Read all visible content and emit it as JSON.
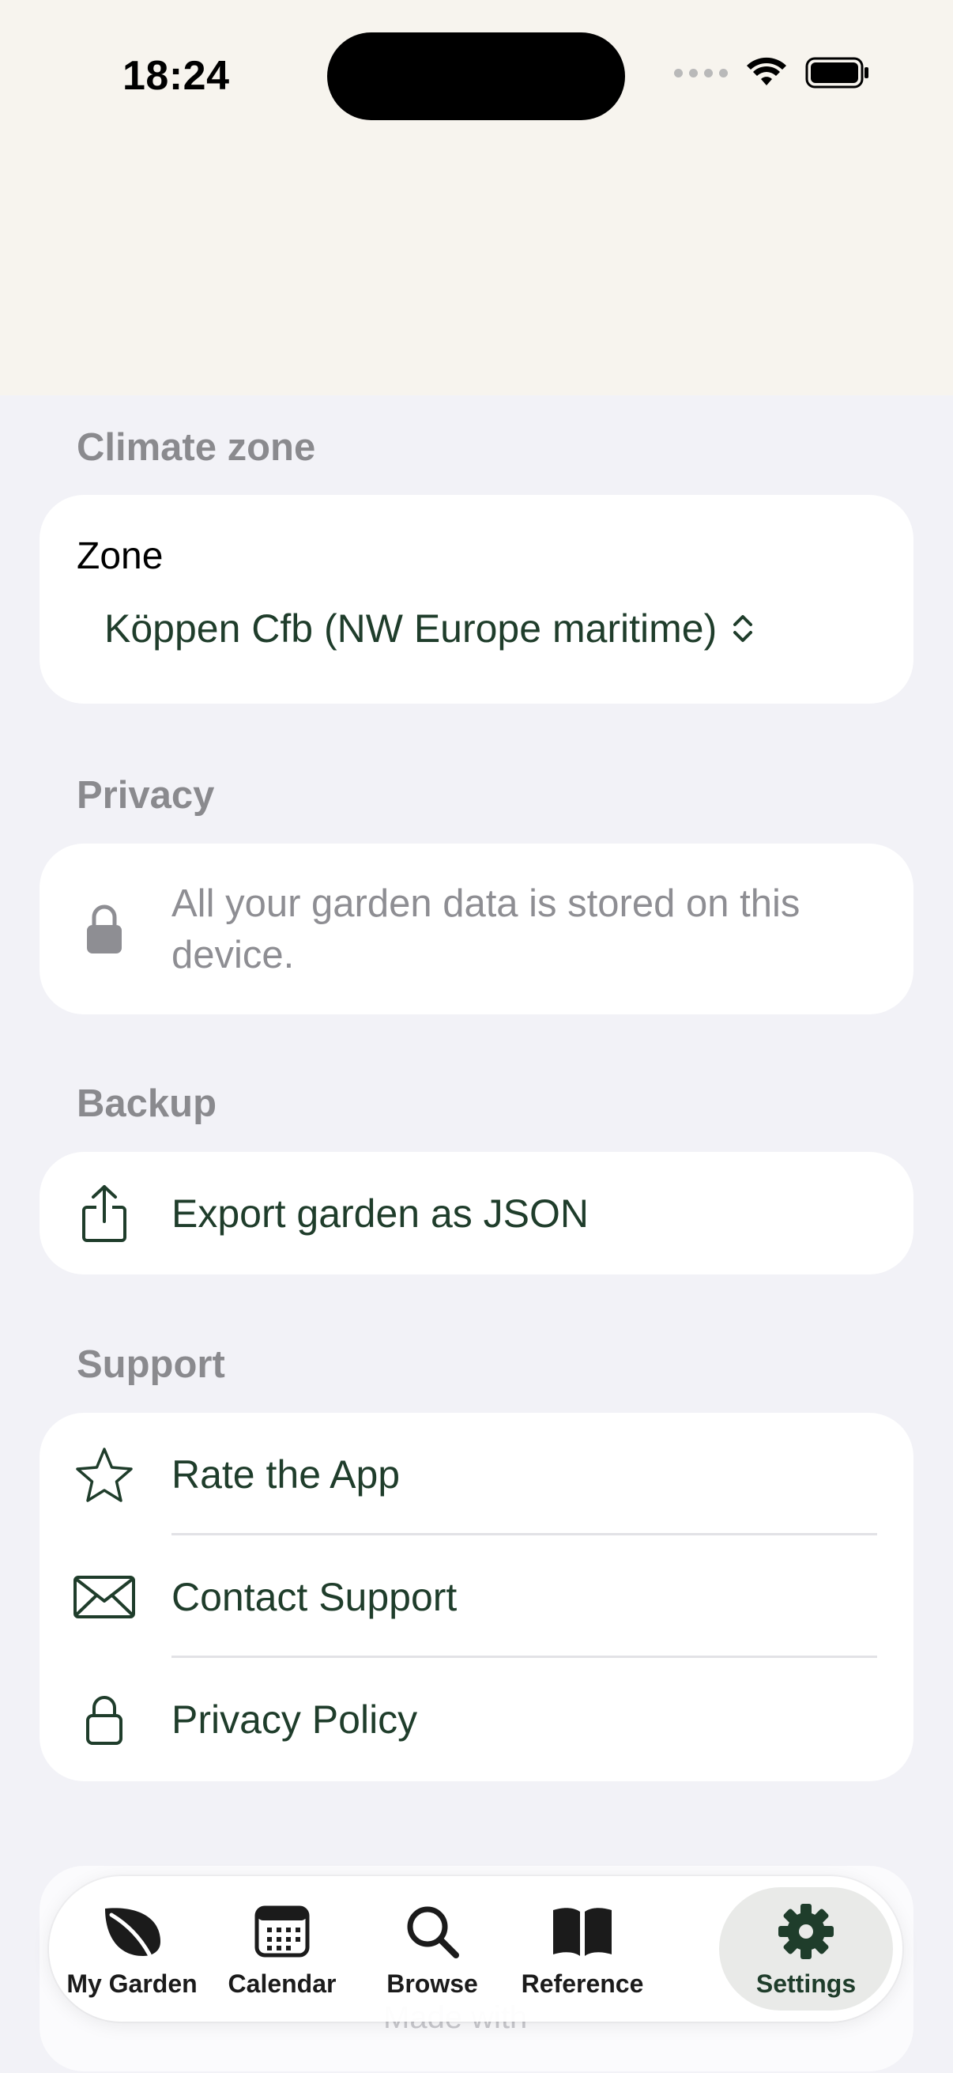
{
  "status_bar": {
    "time": "18:24"
  },
  "sections": {
    "climate": {
      "header": "Climate zone",
      "zone_label": "Zone",
      "zone_value": "Köppen Cfb (NW Europe maritime)"
    },
    "privacy": {
      "header": "Privacy",
      "text": "All your garden data is stored on this device."
    },
    "backup": {
      "header": "Backup",
      "export_label": "Export garden as JSON"
    },
    "support": {
      "header": "Support",
      "items": [
        {
          "label": "Rate the App",
          "icon": "star-icon"
        },
        {
          "label": "Contact Support",
          "icon": "envelope-icon"
        },
        {
          "label": "Privacy Policy",
          "icon": "lock-icon"
        }
      ]
    }
  },
  "footer": {
    "made_with": "Made with"
  },
  "tabbar": {
    "tabs": [
      {
        "label": "My Garden",
        "icon": "leaf-icon"
      },
      {
        "label": "Calendar",
        "icon": "calendar-icon"
      },
      {
        "label": "Browse",
        "icon": "search-icon"
      },
      {
        "label": "Reference",
        "icon": "book-icon"
      },
      {
        "label": "Settings",
        "icon": "gear-icon",
        "active": true
      }
    ]
  },
  "colors": {
    "accent": "#1f3d2b",
    "background": "#f2f2f7",
    "status_bg": "#f7f4ee",
    "secondary_text": "#8e8e93"
  }
}
